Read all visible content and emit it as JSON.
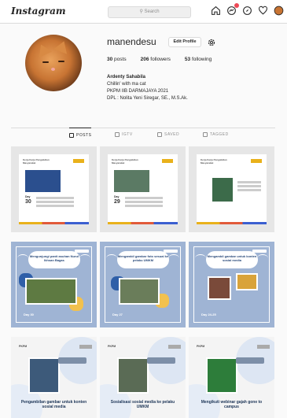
{
  "nav": {
    "logo": "Instagram",
    "search_placeholder": "Search",
    "icons": [
      "home-icon",
      "messenger-icon",
      "explore-icon",
      "heart-icon",
      "avatar-icon"
    ],
    "notification_color": "#ed4956"
  },
  "profile": {
    "username": "manendesu",
    "edit_label": "Edit Profile",
    "posts_count": "30",
    "posts_label": "posts",
    "followers_count": "206",
    "followers_label": "followers",
    "following_count": "53",
    "following_label": "following",
    "full_name": "Ardenty Sahabila",
    "bio_line1": "Chillin' with ma cat",
    "bio_line2": "PKPM IIB DARMAJAYA 2021",
    "bio_line3": "DPL : Nolita Yeni Siregar, SE., M.S.Ak."
  },
  "tabs": [
    {
      "label": "POSTS",
      "active": true
    },
    {
      "label": "IGTV",
      "active": false
    },
    {
      "label": "SAVED",
      "active": false
    },
    {
      "label": "TAGGED",
      "active": false
    }
  ],
  "posts": {
    "row1": [
      {
        "title": "Kerja Kerja Pengabdian Masyarakat",
        "day_label": "Day",
        "day_num": "30"
      },
      {
        "title": "Kerja Kerja Pengabdian Masyarakat",
        "day_label": "Day",
        "day_num": "29"
      },
      {
        "title": "Kerja Kerja Pengabdian Masyarakat",
        "day_label": "",
        "day_num": ""
      }
    ],
    "row2": [
      {
        "bubble": "Mengunjungi panti asuhan Nurul Ikhsan Bagas",
        "day": "Day 30"
      },
      {
        "bubble": "Mengambil gambar foto sesuai ke pelaku UMKM",
        "day": "Day 27"
      },
      {
        "bubble": "Mengambil gambar untuk konten sosial media",
        "day": "Day 24-25"
      }
    ],
    "row3": [
      {
        "tag": "PKPM",
        "caption": "Pengambilan gambar untuk konten sosial media"
      },
      {
        "tag": "PKPM",
        "caption": "Sosialisasi sosial media ke pelaku UMKM"
      },
      {
        "tag": "PKPM",
        "caption": "Mengikuti webinar gajah gone to campus"
      }
    ]
  }
}
